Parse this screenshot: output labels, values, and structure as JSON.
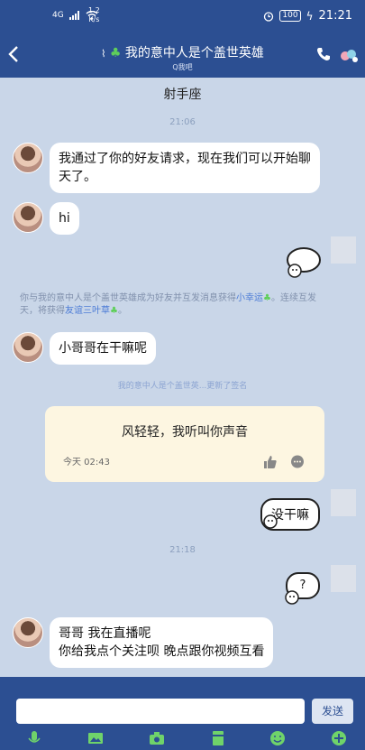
{
  "status_bar": {
    "network": "4G",
    "speed_value": "1.2",
    "speed_unit": "K/s",
    "battery": "100",
    "time": "21:21"
  },
  "nav": {
    "title": "我的意中人是个盖世英雄",
    "subtitle": "Q我吧",
    "back_icon": "back-arrow-icon",
    "phone_icon": "phone-icon",
    "more_icon": "more-icon"
  },
  "chat": {
    "group_label": "射手座",
    "time1": "21:06",
    "msg1": "我通过了你的好友请求，现在我们可以开始聊天了。",
    "msg2": "hi",
    "system": {
      "part1": "你与我的意中人是个盖世英雄成为好友并互发消息获得",
      "link1": "小幸运",
      "part2": "。连续互发",
      "part3": "天，将获得",
      "link2": "友谊三叶草",
      "part4": "。"
    },
    "msg3": "小哥哥在干嘛呢",
    "signature_notice": "我的意中人是个盖世英...更新了签名",
    "card": {
      "text": "风轻轻，我听叫你声音",
      "time": "今天 02:43"
    },
    "sent_text": "没干嘛",
    "time2": "21:18",
    "sticker_q": "?",
    "msg4_line1": "哥哥 我在直播呢",
    "msg4_line2": "你给我点个关注呗 晚点跟你视频互看"
  },
  "input": {
    "placeholder": "",
    "send_label": "发送"
  },
  "colors": {
    "header": "#2c4f92",
    "chat_bg": "#c9d6e8",
    "card_bg": "#fdf6e1",
    "link": "#4b7bd6"
  }
}
